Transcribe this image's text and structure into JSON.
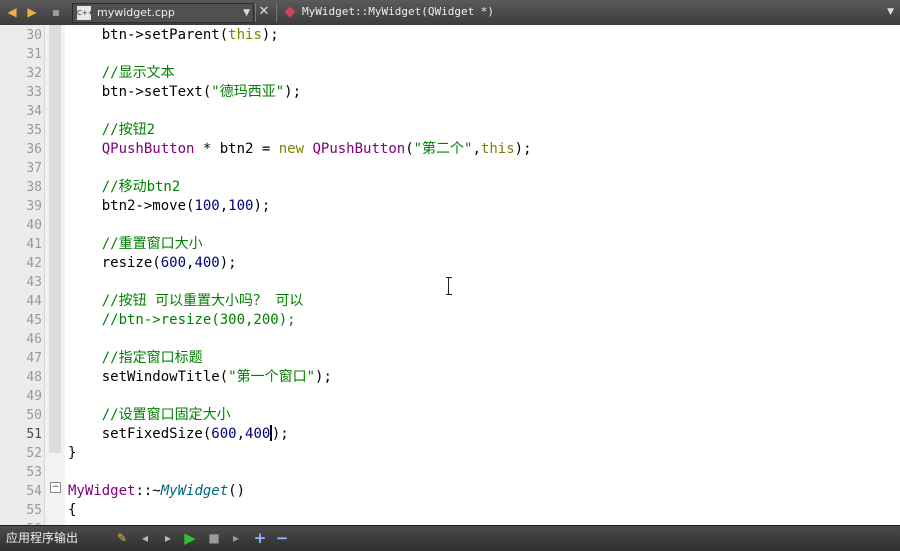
{
  "toolbar": {
    "nav_back": "◆",
    "nav_forward": "◆",
    "lock": "■",
    "file_name": "mywidget.cpp",
    "file_badge": "C++",
    "symbol_name": "MyWidget::MyWidget(QWidget *)",
    "dropdown_arrow": "▼",
    "close": "✕"
  },
  "editor": {
    "fold_minus": "−",
    "lines": [
      {
        "num": "30",
        "tokens": [
          {
            "t": "    btn->setParent(",
            "c": ""
          },
          {
            "t": "this",
            "c": "keyword"
          },
          {
            "t": ");",
            "c": ""
          }
        ]
      },
      {
        "num": "31",
        "tokens": []
      },
      {
        "num": "32",
        "tokens": [
          {
            "t": "    //显示文本",
            "c": "comment"
          }
        ]
      },
      {
        "num": "33",
        "tokens": [
          {
            "t": "    btn->setText(",
            "c": ""
          },
          {
            "t": "\"德玛西亚\"",
            "c": "string"
          },
          {
            "t": ");",
            "c": ""
          }
        ]
      },
      {
        "num": "34",
        "tokens": []
      },
      {
        "num": "35",
        "tokens": [
          {
            "t": "    //按钮2",
            "c": "comment"
          }
        ]
      },
      {
        "num": "36",
        "tokens": [
          {
            "t": "    ",
            "c": ""
          },
          {
            "t": "QPushButton",
            "c": "class"
          },
          {
            "t": " * btn2 = ",
            "c": ""
          },
          {
            "t": "new",
            "c": "keyword"
          },
          {
            "t": " ",
            "c": ""
          },
          {
            "t": "QPushButton",
            "c": "class"
          },
          {
            "t": "(",
            "c": ""
          },
          {
            "t": "\"第二个\"",
            "c": "string"
          },
          {
            "t": ",",
            "c": ""
          },
          {
            "t": "this",
            "c": "keyword"
          },
          {
            "t": ");",
            "c": ""
          }
        ]
      },
      {
        "num": "37",
        "tokens": []
      },
      {
        "num": "38",
        "tokens": [
          {
            "t": "    //移动btn2",
            "c": "comment"
          }
        ]
      },
      {
        "num": "39",
        "tokens": [
          {
            "t": "    btn2->move(",
            "c": ""
          },
          {
            "t": "100",
            "c": "number"
          },
          {
            "t": ",",
            "c": ""
          },
          {
            "t": "100",
            "c": "number"
          },
          {
            "t": ");",
            "c": ""
          }
        ]
      },
      {
        "num": "40",
        "tokens": []
      },
      {
        "num": "41",
        "tokens": [
          {
            "t": "    //重置窗口大小",
            "c": "comment"
          }
        ]
      },
      {
        "num": "42",
        "tokens": [
          {
            "t": "    resize(",
            "c": ""
          },
          {
            "t": "600",
            "c": "number"
          },
          {
            "t": ",",
            "c": ""
          },
          {
            "t": "400",
            "c": "number"
          },
          {
            "t": ");",
            "c": ""
          }
        ]
      },
      {
        "num": "43",
        "tokens": []
      },
      {
        "num": "44",
        "tokens": [
          {
            "t": "    //按钮 可以重置大小吗？ 可以",
            "c": "comment"
          }
        ]
      },
      {
        "num": "45",
        "tokens": [
          {
            "t": "    //btn->resize(300,200);",
            "c": "comment"
          }
        ]
      },
      {
        "num": "46",
        "tokens": []
      },
      {
        "num": "47",
        "tokens": [
          {
            "t": "    //指定窗口标题",
            "c": "comment"
          }
        ]
      },
      {
        "num": "48",
        "tokens": [
          {
            "t": "    setWindowTitle(",
            "c": ""
          },
          {
            "t": "\"第一个窗口\"",
            "c": "string"
          },
          {
            "t": ");",
            "c": ""
          }
        ]
      },
      {
        "num": "49",
        "tokens": []
      },
      {
        "num": "50",
        "tokens": [
          {
            "t": "    //设置窗口固定大小",
            "c": "comment"
          }
        ]
      },
      {
        "num": "51",
        "current": true,
        "tokens": [
          {
            "t": "    setFixedSize(",
            "c": ""
          },
          {
            "t": "600",
            "c": "number"
          },
          {
            "t": ",",
            "c": ""
          },
          {
            "t": "400",
            "c": "number"
          },
          {
            "t": "",
            "c": "caret"
          },
          {
            "t": ");",
            "c": ""
          }
        ]
      },
      {
        "num": "52",
        "tokens": [
          {
            "t": "}",
            "c": ""
          }
        ]
      },
      {
        "num": "53",
        "tokens": []
      },
      {
        "num": "54",
        "tokens": [
          {
            "t": "MyWidget",
            "c": "class"
          },
          {
            "t": "::~",
            "c": ""
          },
          {
            "t": "MyWidget",
            "c": "func-italic"
          },
          {
            "t": "()",
            "c": ""
          }
        ]
      },
      {
        "num": "55",
        "tokens": [
          {
            "t": "{",
            "c": ""
          }
        ]
      },
      {
        "num": "56",
        "tokens": []
      }
    ]
  },
  "statusbar": {
    "output_label": "应用程序输出"
  },
  "colors": {
    "comment": "#008000",
    "keyword": "#808000",
    "class": "#800080",
    "number": "#000080",
    "run": "#2fbf2f"
  }
}
